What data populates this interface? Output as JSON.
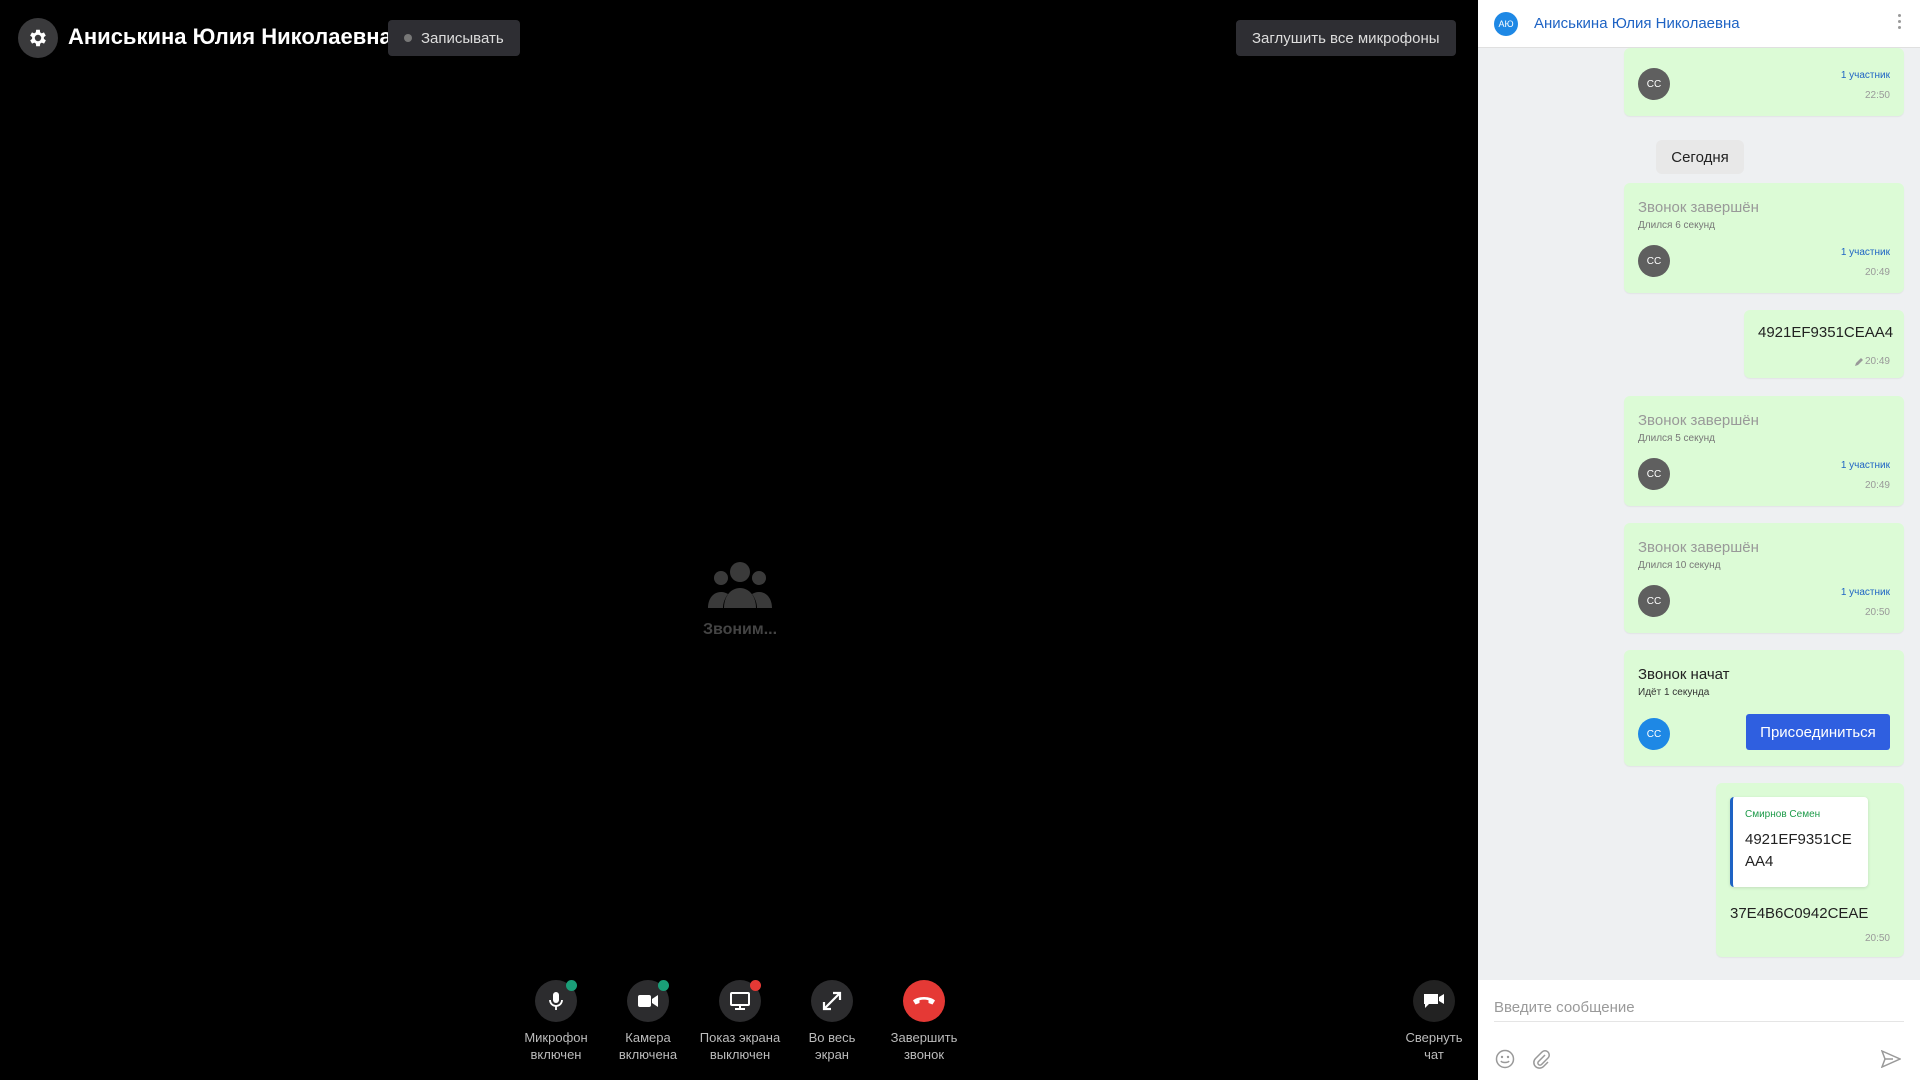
{
  "call": {
    "title": "Аниськина Юлия Николаевна",
    "record_label": "Записывать",
    "mute_all_label": "Заглушить все микрофоны",
    "calling_label": "Звоним..."
  },
  "controls": {
    "mic": {
      "line1": "Микрофон",
      "line2": "включен",
      "status_color": "#1a9e78"
    },
    "camera": {
      "line1": "Камера",
      "line2": "включена",
      "status_color": "#1a9e78"
    },
    "screen": {
      "line1": "Показ экрана",
      "line2": "выключен",
      "status_color": "#e53935"
    },
    "fullscreen": {
      "line1": "Во весь",
      "line2": "экран"
    },
    "hangup": {
      "line1": "Завершить",
      "line2": "звонок"
    },
    "collapse": {
      "line1": "Свернуть",
      "line2": "чат"
    }
  },
  "chat": {
    "avatar": "АЮ",
    "name": "Аниськина Юлия Николаевна",
    "date_separator": "Сегодня",
    "messages": [
      {
        "participants": "1 участник",
        "time": "22:50",
        "avatar": "СС"
      },
      {
        "title": "Звонок завершён",
        "sub": "Длился 6 секунд",
        "participants": "1 участник",
        "time": "20:49",
        "avatar": "СС"
      },
      {
        "text": "4921EF9351CEAA4",
        "time": "20:49",
        "edited": true
      },
      {
        "title": "Звонок завершён",
        "sub": "Длился 5 секунд",
        "participants": "1 участник",
        "time": "20:49",
        "avatar": "СС"
      },
      {
        "title": "Звонок завершён",
        "sub": "Длился 10 секунд",
        "participants": "1 участник",
        "time": "20:50",
        "avatar": "СС"
      },
      {
        "title": "Звонок начат",
        "sub": "Идёт 1 секунда",
        "avatar": "СС",
        "join_label": "Присоединиться"
      },
      {
        "reply_author": "Смирнов Семен",
        "reply_text": "4921EF9351CEAA4",
        "text": "37E4B6C0942CEAE",
        "time": "20:50"
      }
    ],
    "input_placeholder": "Введите сообщение"
  },
  "colors": {
    "accent": "#2f5fe0",
    "bubble": "#dcfbd6",
    "hangup": "#e53935",
    "on": "#1a9e78"
  }
}
